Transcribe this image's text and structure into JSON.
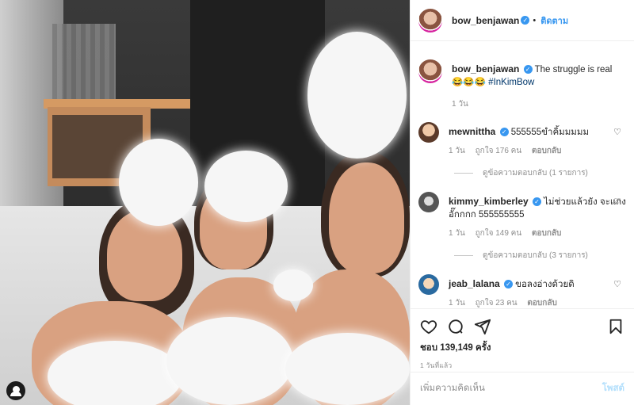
{
  "header": {
    "username": "bow_benjawan",
    "follow_label": "ติดตาม",
    "dot": "•"
  },
  "caption": {
    "username": "bow_benjawan",
    "text": "The struggle is real",
    "emojis": "😂😂😂",
    "hashtag": "#InKimBow",
    "time": "1 วัน"
  },
  "comments": [
    {
      "username": "mewnittha",
      "text": "555555ขำคิ้มมมมม",
      "time": "1 วัน",
      "likes": "ถูกใจ 176 คน",
      "reply_label": "ตอบกลับ",
      "view_replies": "ดูข้อความตอบกลับ (1 รายการ)"
    },
    {
      "username": "kimmy_kimberley",
      "text": "ไม่ช่วยแล้วยัง จะแกงอั๊กกกก 555555555",
      "time": "1 วัน",
      "likes": "ถูกใจ 149 คน",
      "reply_label": "ตอบกลับ",
      "view_replies": "ดูข้อความตอบกลับ (3 รายการ)"
    },
    {
      "username": "jeab_lalana",
      "text": "ขอลงอ่างด้วยดิ",
      "time": "1 วัน",
      "likes": "ถูกใจ 23 คน",
      "reply_label": "ตอบกลับ"
    }
  ],
  "actions": {
    "likes_text": "ชอบ 139,149 ครั้ง",
    "time_ago": "1 วันที่แล้ว"
  },
  "add_comment": {
    "placeholder": "เพิ่มความคิดเห็น",
    "post_label": "โพสต์"
  },
  "icons": {
    "like": "heart-icon",
    "comment": "comment-icon",
    "share": "share-icon",
    "save": "bookmark-icon",
    "comment_like": "heart-icon",
    "verified": "verified-badge-icon",
    "media_profile": "user-tag-icon"
  },
  "colors": {
    "accent": "#3897f0",
    "hashtag": "#00376b",
    "muted": "#8e8e8e",
    "post_disabled": "#b2dffc"
  }
}
